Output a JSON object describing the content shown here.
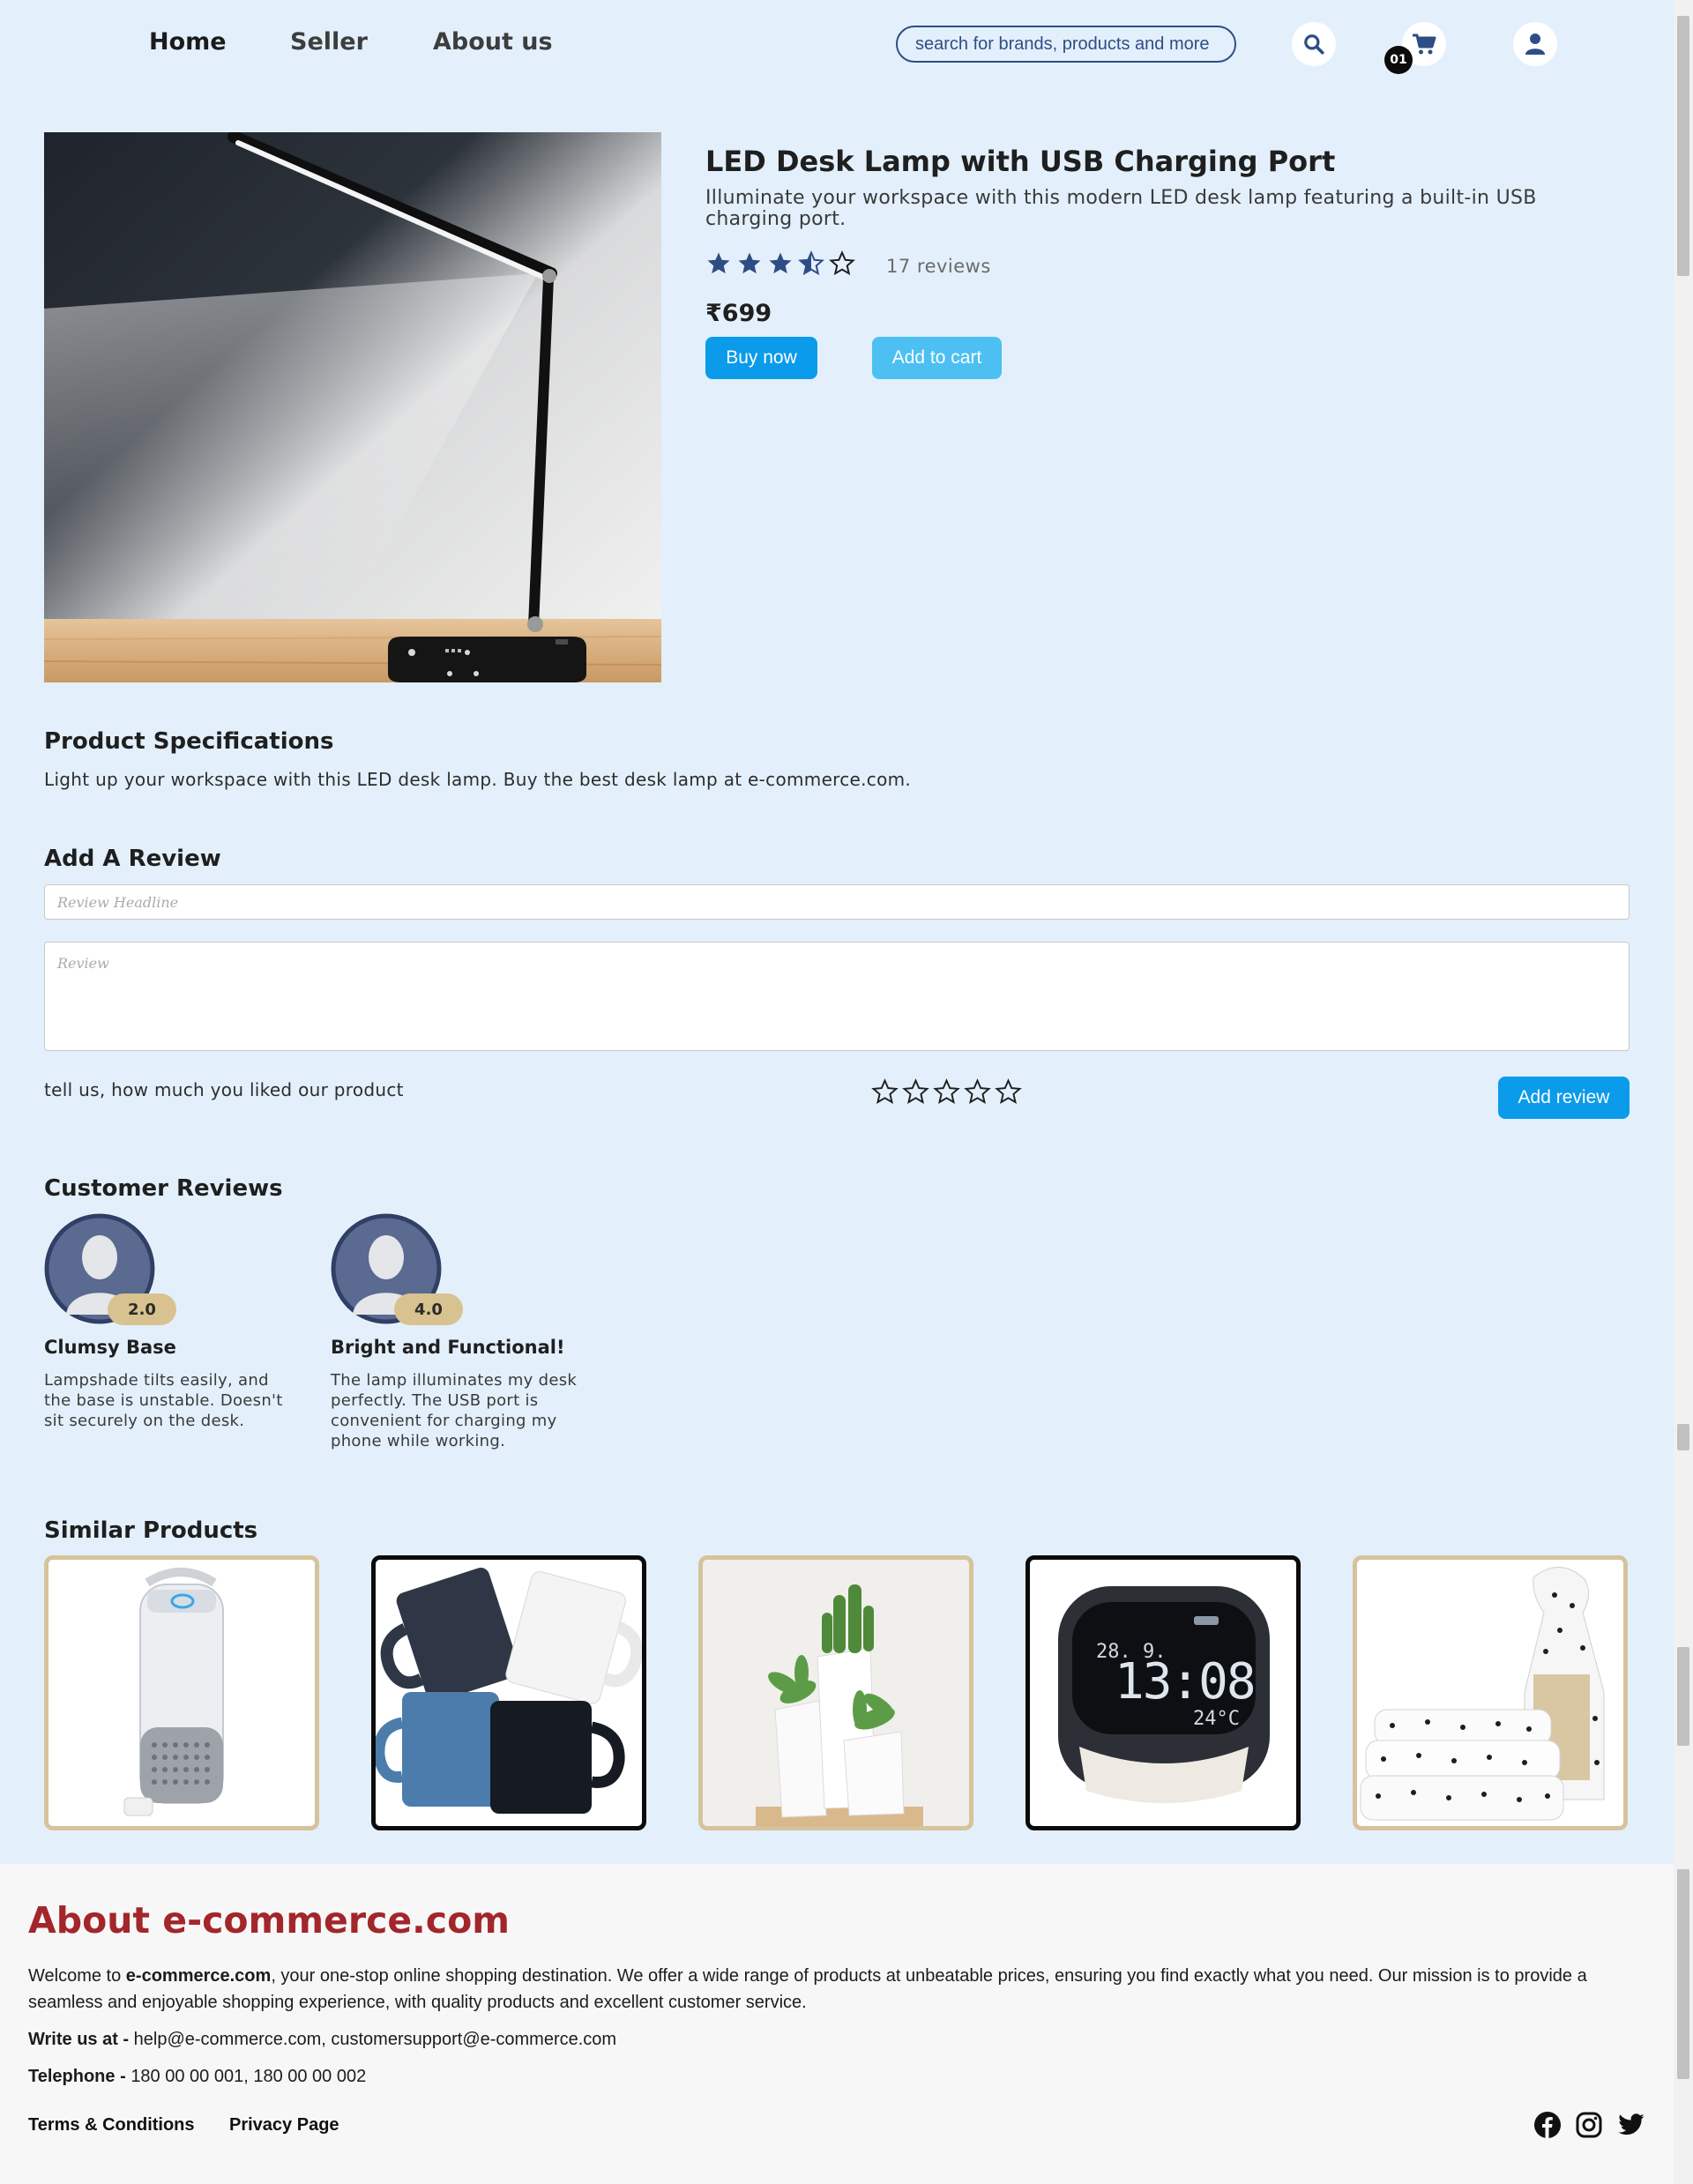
{
  "nav": {
    "links": [
      "Home",
      "Seller",
      "About us"
    ],
    "search_placeholder": "search for brands, products and more",
    "cart_count": "01"
  },
  "product": {
    "title": "LED Desk Lamp with USB Charging Port",
    "description": "Illuminate your workspace with this modern LED desk lamp featuring a built-in USB charging port.",
    "rating": 3.5,
    "reviews_count": "17 reviews",
    "price": "₹699",
    "buy_label": "Buy now",
    "cart_label": "Add to cart"
  },
  "specs": {
    "heading": "Product Specifications",
    "text": "Light up your workspace with this LED desk lamp. Buy the best desk lamp at e-commerce.com."
  },
  "review_form": {
    "heading": "Add A Review",
    "headline_placeholder": "Review Headline",
    "review_placeholder": "Review",
    "prompt": "tell us, how much you liked our product",
    "submit_label": "Add review"
  },
  "customer_reviews": {
    "heading": "Customer Reviews",
    "items": [
      {
        "rating": "2.0",
        "title": "Clumsy Base",
        "body": "Lampshade tilts easily, and the base is unstable. Doesn't sit securely on the desk."
      },
      {
        "rating": "4.0",
        "title": "Bright and Functional!",
        "body": "The lamp illuminates my desk perfectly. The USB port is convenient for charging my phone while working."
      }
    ]
  },
  "similar": {
    "heading": "Similar Products",
    "items": [
      {
        "name": "air-purifier",
        "clock_date": "",
        "clock_time": "",
        "clock_temp": ""
      },
      {
        "name": "mugs"
      },
      {
        "name": "succulent-planters"
      },
      {
        "name": "alarm-clock",
        "clock_date": "28. 9.",
        "clock_time": "13:08",
        "clock_temp": "24°C"
      },
      {
        "name": "polka-dot-bedsheets"
      }
    ]
  },
  "footer": {
    "title": "About e-commerce.com",
    "intro_brand": "e-commerce.com",
    "intro_before": "Welcome to ",
    "intro_after": ", your one-stop online shopping destination. We offer a wide range of products at unbeatable prices, ensuring you find exactly what you need. Our mission is to provide a seamless and enjoyable shopping experience, with quality products and excellent customer service.",
    "write_label": "Write us at - ",
    "write_value": "help@e-commerce.com, customersupport@e-commerce.com",
    "phone_label": "Telephone - ",
    "phone_value": "180 00 00 001, 180 00 00 002",
    "terms": "Terms & Conditions",
    "privacy": "Privacy Page"
  },
  "colors": {
    "background": "#e3f0fc",
    "accent": "#0a9bea",
    "star": "#2f4d85",
    "footer_title": "#a3262a"
  }
}
